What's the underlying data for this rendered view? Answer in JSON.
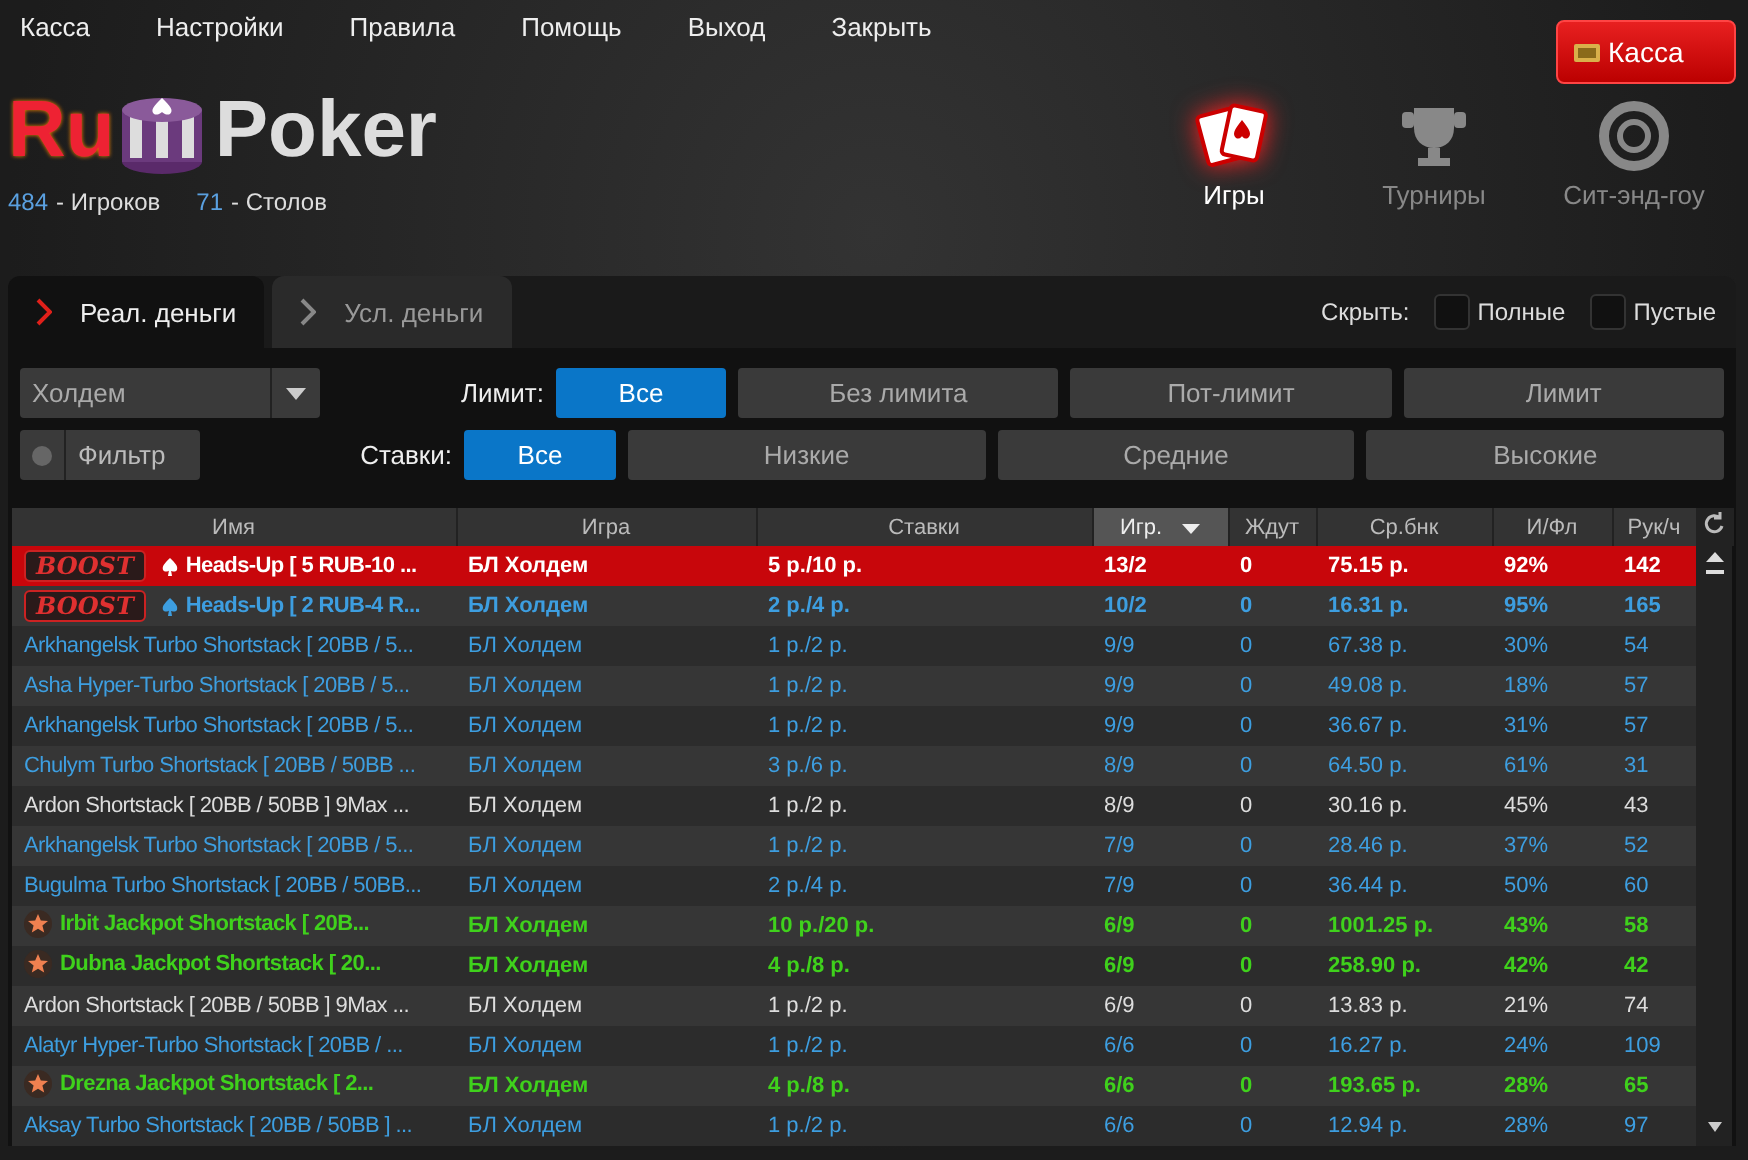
{
  "menu": [
    "Касса",
    "Настройки",
    "Правила",
    "Помощь",
    "Выход",
    "Закрыть"
  ],
  "cashier_button": {
    "label": "Касса"
  },
  "logo": {
    "text_left": "Ru",
    "text_right": "Poker"
  },
  "stats": [
    {
      "count": "484",
      "label": "- Игроков"
    },
    {
      "count": "71",
      "label": "- Столов"
    }
  ],
  "nav": [
    {
      "label": "Игры",
      "selected": true,
      "kind": "cards"
    },
    {
      "label": "Турниры",
      "selected": false,
      "kind": "trophy"
    },
    {
      "label": "Сит-энд-гоу",
      "selected": false,
      "kind": "ring"
    }
  ],
  "tabs": [
    {
      "label": "Реал. деньги",
      "selected": true
    },
    {
      "label": "Усл. деньги",
      "selected": false
    }
  ],
  "hide": {
    "label": "Скрыть:",
    "options": [
      {
        "label": "Полные",
        "checked": false
      },
      {
        "label": "Пустые",
        "checked": false
      }
    ]
  },
  "game_select": {
    "value": "Холдем"
  },
  "filter_button": {
    "label": "Фильтр"
  },
  "limit": {
    "label": "Лимит:",
    "options": [
      {
        "label": "Все",
        "selected": true
      },
      {
        "label": "Без лимита",
        "selected": false
      },
      {
        "label": "Пот-лимит",
        "selected": false
      },
      {
        "label": "Лимит",
        "selected": false
      }
    ]
  },
  "stakes": {
    "label": "Ставки:",
    "options": [
      {
        "label": "Все",
        "selected": true
      },
      {
        "label": "Низкие",
        "selected": false
      },
      {
        "label": "Средние",
        "selected": false
      },
      {
        "label": "Высокие",
        "selected": false
      }
    ]
  },
  "table": {
    "columns": [
      {
        "label": "Имя",
        "sorted": false
      },
      {
        "label": "Игра",
        "sorted": false
      },
      {
        "label": "Ставки",
        "sorted": false
      },
      {
        "label": "Игр.",
        "sorted": true
      },
      {
        "label": "Ждут",
        "sorted": false
      },
      {
        "label": "Ср.бнк",
        "sorted": false
      },
      {
        "label": "И/Фл",
        "sorted": false
      },
      {
        "label": "Рук/ч",
        "sorted": false
      }
    ],
    "rows": [
      {
        "kind": "boost",
        "badge": "BOOST",
        "selected": true,
        "color": "#ffffff",
        "cells": [
          "Heads-Up [ 5 RUB-10 ...",
          "БЛ Холдем",
          "5 р./10 р.",
          "13/2",
          "0",
          "75.15 р.",
          "92%",
          "142"
        ]
      },
      {
        "kind": "boost",
        "badge": "BOOST",
        "selected": false,
        "color": "#3d9ee0",
        "cells": [
          "Heads-Up [ 2 RUB-4 R...",
          "БЛ Холдем",
          "2 р./4 р.",
          "10/2",
          "0",
          "16.31 р.",
          "95%",
          "165"
        ]
      },
      {
        "kind": "plain",
        "selected": false,
        "color": "#3d9ee0",
        "cells": [
          "Arkhangelsk Turbo Shortstack [ 20BB / 5...",
          "БЛ Холдем",
          "1 р./2 р.",
          "9/9",
          "0",
          "67.38 р.",
          "30%",
          "54"
        ]
      },
      {
        "kind": "plain",
        "selected": false,
        "color": "#3d9ee0",
        "cells": [
          "Asha Hyper-Turbo Shortstack [ 20BB / 5...",
          "БЛ Холдем",
          "1 р./2 р.",
          "9/9",
          "0",
          "49.08 р.",
          "18%",
          "57"
        ]
      },
      {
        "kind": "plain",
        "selected": false,
        "color": "#3d9ee0",
        "cells": [
          "Arkhangelsk Turbo Shortstack [ 20BB / 5...",
          "БЛ Холдем",
          "1 р./2 р.",
          "9/9",
          "0",
          "36.67 р.",
          "31%",
          "57"
        ]
      },
      {
        "kind": "plain",
        "selected": false,
        "color": "#3d9ee0",
        "cells": [
          "Chulym Turbo Shortstack [ 20BB / 50BB ...",
          "БЛ Холдем",
          "3 р./6 р.",
          "8/9",
          "0",
          "64.50 р.",
          "61%",
          "31"
        ]
      },
      {
        "kind": "plain",
        "selected": false,
        "color": "#dddddd",
        "cells": [
          "Ardon Shortstack [ 20BB / 50BB ] 9Max ...",
          "БЛ Холдем",
          "1 р./2 р.",
          "8/9",
          "0",
          "30.16 р.",
          "45%",
          "43"
        ]
      },
      {
        "kind": "plain",
        "selected": false,
        "color": "#3d9ee0",
        "cells": [
          "Arkhangelsk Turbo Shortstack [ 20BB / 5...",
          "БЛ Холдем",
          "1 р./2 р.",
          "7/9",
          "0",
          "28.46 р.",
          "37%",
          "52"
        ]
      },
      {
        "kind": "plain",
        "selected": false,
        "color": "#3d9ee0",
        "cells": [
          "Bugulma Turbo Shortstack [ 20BB / 50BB...",
          "БЛ Холдем",
          "2 р./4 р.",
          "7/9",
          "0",
          "36.44 р.",
          "50%",
          "60"
        ]
      },
      {
        "kind": "jackpot",
        "selected": false,
        "color": "#3fd11c",
        "cells": [
          "Irbit Jackpot Shortstack [ 20B...",
          "БЛ Холдем",
          "10 р./20 р.",
          "6/9",
          "0",
          "1001.25 р.",
          "43%",
          "58"
        ]
      },
      {
        "kind": "jackpot",
        "selected": false,
        "color": "#3fd11c",
        "cells": [
          "Dubna Jackpot Shortstack [ 20...",
          "БЛ Холдем",
          "4 р./8 р.",
          "6/9",
          "0",
          "258.90 р.",
          "42%",
          "42"
        ]
      },
      {
        "kind": "plain",
        "selected": false,
        "color": "#dddddd",
        "cells": [
          "Ardon Shortstack [ 20BB / 50BB ] 9Max ...",
          "БЛ Холдем",
          "1 р./2 р.",
          "6/9",
          "0",
          "13.83 р.",
          "21%",
          "74"
        ]
      },
      {
        "kind": "plain",
        "selected": false,
        "color": "#3d9ee0",
        "cells": [
          "Alatyr Hyper-Turbo Shortstack [ 20BB / ...",
          "БЛ Холдем",
          "1 р./2 р.",
          "6/6",
          "0",
          "16.27 р.",
          "24%",
          "109"
        ]
      },
      {
        "kind": "jackpot",
        "selected": false,
        "color": "#3fd11c",
        "cells": [
          "Drezna Jackpot Shortstack [ 2...",
          "БЛ Холдем",
          "4 р./8 р.",
          "6/6",
          "0",
          "193.65 р.",
          "28%",
          "65"
        ]
      },
      {
        "kind": "plain",
        "selected": false,
        "color": "#3d9ee0",
        "cells": [
          "Aksay Turbo Shortstack [ 20BB / 50BB ] ...",
          "БЛ Холдем",
          "1 р./2 р.",
          "6/6",
          "0",
          "12.94 р.",
          "28%",
          "97"
        ]
      }
    ]
  }
}
